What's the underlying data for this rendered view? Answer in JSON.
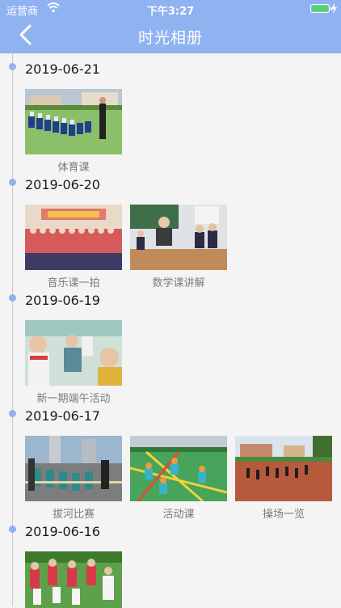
{
  "status_bar": {
    "carrier": "运营商",
    "time": "下午3:27"
  },
  "nav": {
    "title": "时光相册"
  },
  "groups": [
    {
      "date": "2019-06-21",
      "photos": [
        {
          "caption": "体育课"
        }
      ]
    },
    {
      "date": "2019-06-20",
      "photos": [
        {
          "caption": "音乐课一拍"
        },
        {
          "caption": "数学课讲解"
        }
      ]
    },
    {
      "date": "2019-06-19",
      "photos": [
        {
          "caption": "新一期端午活动"
        }
      ]
    },
    {
      "date": "2019-06-17",
      "photos": [
        {
          "caption": "拔河比赛"
        },
        {
          "caption": "活动课"
        },
        {
          "caption": "操场一览"
        }
      ]
    },
    {
      "date": "2019-06-16",
      "photos": [
        {
          "caption": ""
        }
      ]
    }
  ],
  "colors": {
    "header": "#8fb2f0",
    "dot": "#8fb2f0",
    "battery": "#4cd964"
  }
}
